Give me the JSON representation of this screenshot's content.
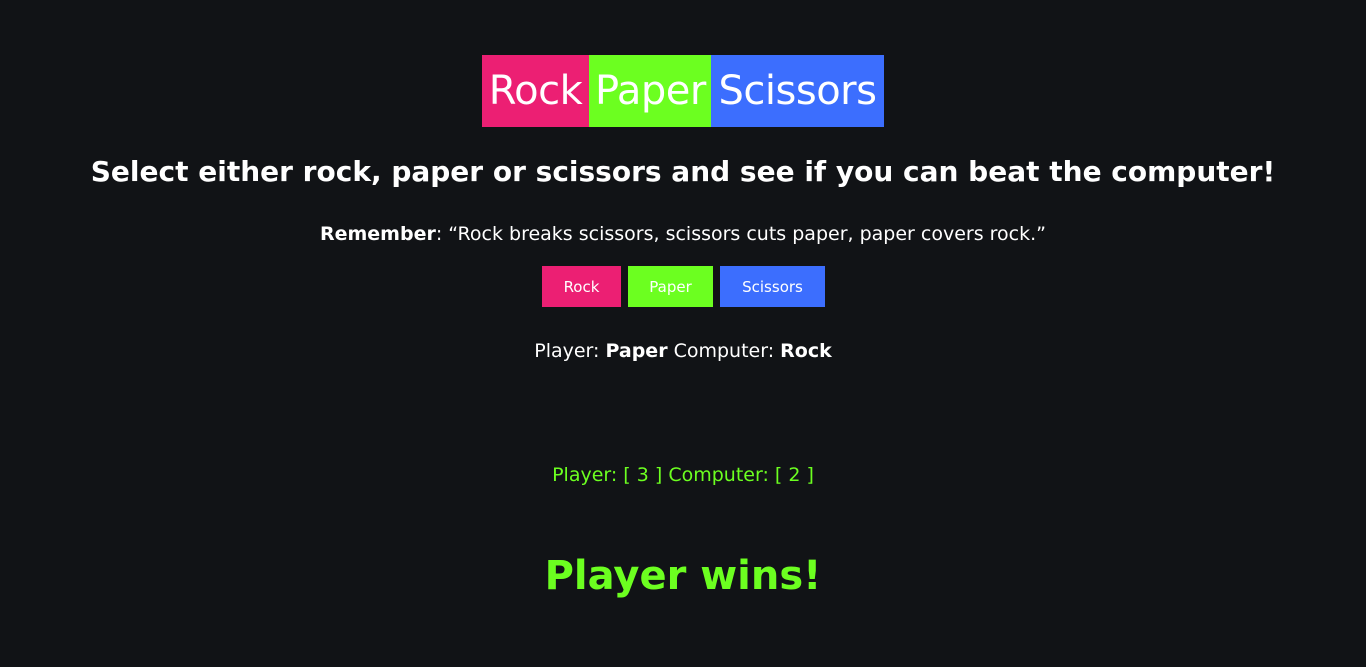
{
  "title": {
    "rock": "Rock",
    "paper": "Paper",
    "scissors": "Scissors"
  },
  "subtitle": "Select either rock, paper or scissors and see if you can beat the computer!",
  "remember": {
    "label": "Remember",
    "text": ": “Rock breaks scissors, scissors cuts paper, paper covers rock.”"
  },
  "buttons": {
    "rock": "Rock",
    "paper": "Paper",
    "scissors": "Scissors"
  },
  "choices": {
    "player_label": "Player: ",
    "player_choice": "Paper",
    "computer_label": " Computer: ",
    "computer_choice": "Rock"
  },
  "score": {
    "player_label": "Player: [ ",
    "player_score": "3",
    "computer_label": " ] Computer: [ ",
    "computer_score": "2",
    "end": " ]"
  },
  "result": "Player wins!",
  "colors": {
    "background": "#111316",
    "rock": "#ec1f73",
    "paper": "#6cff20",
    "scissors": "#3c6efe",
    "text": "#ffffff",
    "accent": "#6cff20"
  }
}
